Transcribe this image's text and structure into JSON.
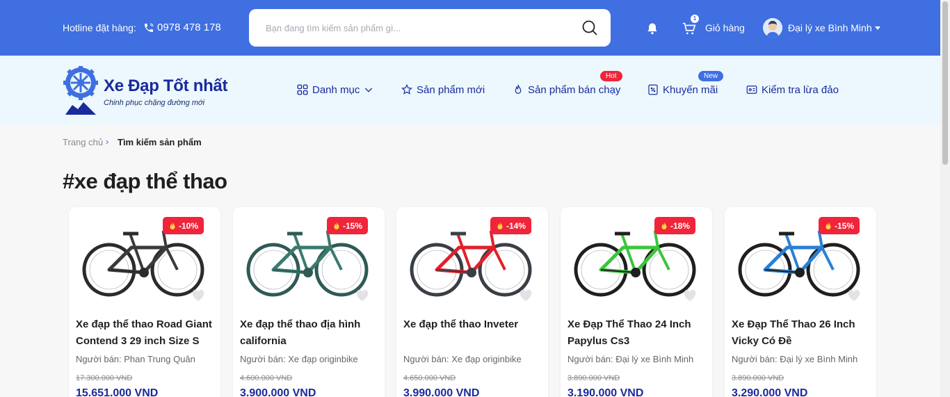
{
  "topbar": {
    "hotline_label": "Hotline đặt hàng:",
    "hotline_phone": "0978 478 178",
    "search_placeholder": "Bạn đang tìm kiếm sản phẩm gì...",
    "cart_count": "1",
    "cart_label": "Giỏ hàng",
    "user_name": "Đại lý xe Bình Minh",
    "colors": {
      "bar": "#3f6fe0",
      "text": "#ffffff"
    }
  },
  "brand": {
    "name": "Xe Đạp Tốt nhất",
    "slogan": "Chinh phục chặng đường mới",
    "color": "#1a2a9c"
  },
  "nav": {
    "items": [
      {
        "label": "Danh mục",
        "icon": "grid-icon"
      },
      {
        "label": "Sản phẩm mới",
        "icon": "star-icon"
      },
      {
        "label": "Sản phẩm bán chạy",
        "icon": "flame-icon",
        "badge": "Hot"
      },
      {
        "label": "Khuyến mãi",
        "icon": "discount-tag-icon",
        "badge": "New"
      },
      {
        "label": "Kiểm tra lừa đảo",
        "icon": "id-card-icon"
      }
    ]
  },
  "breadcrumb": {
    "home": "Trang chủ",
    "separator": "›",
    "current": "Tìm kiếm sản phẩm"
  },
  "page_title": "#xe đạp thể thao",
  "products": [
    {
      "name": "Xe đạp thể thao Road Giant Contend 3 29 inch Size S",
      "seller": "Người bán: Phan Trung Quân",
      "old_price": "17.300.000 VND",
      "price": "15.651.000 VND",
      "discount": "-10%",
      "frame_color": "#2b2b2b",
      "accent": "#3a3a3a"
    },
    {
      "name": "Xe đạp thể thao địa hình california",
      "seller": "Người bán: Xe đạp originbike",
      "old_price": "4.600.000 VND",
      "price": "3.900.000 VND",
      "discount": "-15%",
      "frame_color": "#2f5a55",
      "accent": "#3b7a6e"
    },
    {
      "name": "Xe đạp thể thao Inveter",
      "seller": "Người bán: Xe đạp originbike",
      "old_price": "4.650.000 VND",
      "price": "3.990.000 VND",
      "discount": "-14%",
      "frame_color": "#3a3f45",
      "accent": "#e0202a"
    },
    {
      "name": "Xe Đạp Thể Thao 24 Inch Papylus Cs3",
      "seller": "Người bán: Đại lý xe Bình Minh",
      "old_price": "3.890.000 VND",
      "price": "3.190.000 VND",
      "discount": "-18%",
      "frame_color": "#1f1f1f",
      "accent": "#3cc43c"
    },
    {
      "name": "Xe Đạp Thể Thao 26 Inch Vicky Có Đề",
      "seller": "Người bán: Đại lý xe Bình Minh",
      "old_price": "3.890.000 VND",
      "price": "3.290.000 VND",
      "discount": "-15%",
      "frame_color": "#1f1f1f",
      "accent": "#2a7fd4"
    }
  ]
}
